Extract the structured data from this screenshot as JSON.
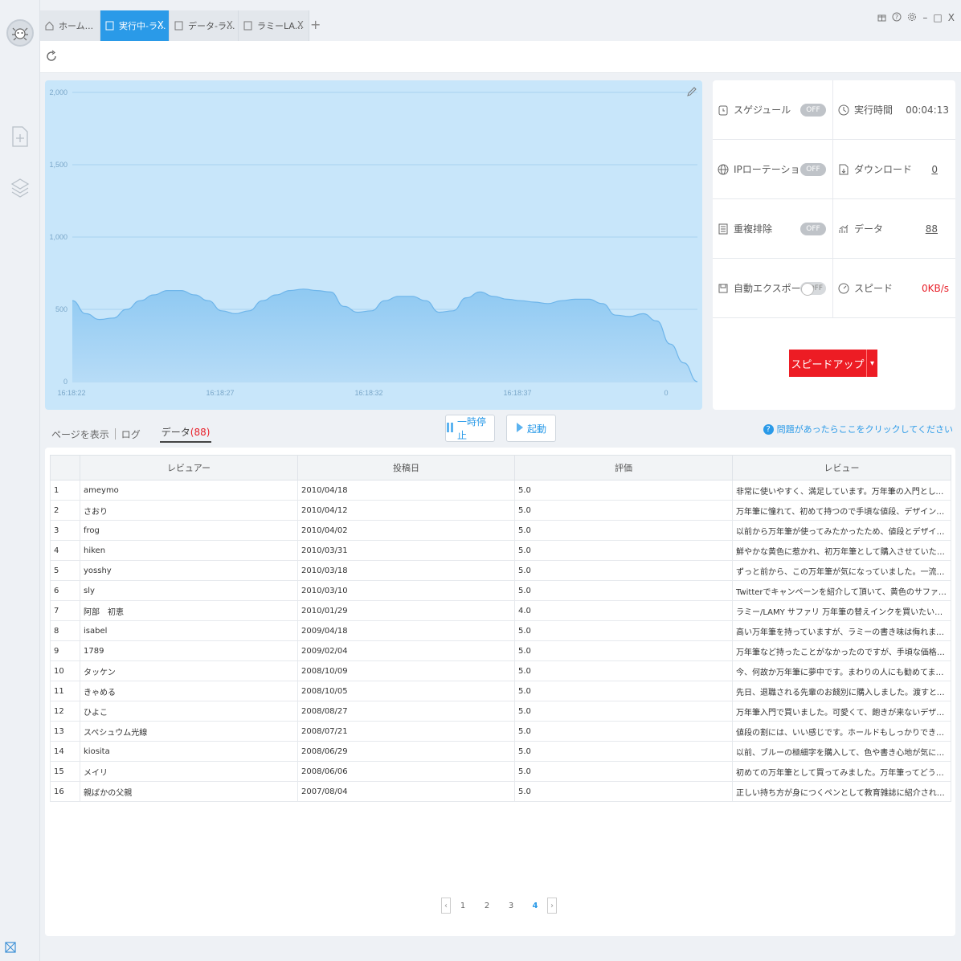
{
  "tabs": [
    {
      "label": "ホーム...",
      "icon": "home-icon",
      "active": false,
      "closable": false
    },
    {
      "label": "実行中-ラ...",
      "icon": "document-icon",
      "active": true,
      "closable": true
    },
    {
      "label": "データ-ラ...",
      "icon": "document-icon",
      "active": false,
      "closable": true
    },
    {
      "label": "ラミーLA...",
      "icon": "document-icon",
      "active": false,
      "closable": true
    }
  ],
  "tab_add": "+",
  "tab_close": "X",
  "window_controls": {
    "gift": "gift-icon",
    "help": "help-icon",
    "settings": "gear-icon",
    "minimize": "–",
    "maximize": "□",
    "close": "X"
  },
  "chart_data": {
    "type": "area",
    "x_tick_labels": [
      "16:18:22",
      "16:18:27",
      "16:18:32",
      "16:18:37",
      "0"
    ],
    "y_tick_labels": [
      "0",
      "500",
      "1,000",
      "1,500",
      "2,000"
    ],
    "ylim": [
      0,
      2000
    ],
    "grid": true,
    "series": [
      {
        "values": [
          560,
          470,
          430,
          440,
          500,
          560,
          600,
          630,
          630,
          600,
          560,
          490,
          470,
          490,
          560,
          600,
          630,
          640,
          630,
          620,
          520,
          480,
          490,
          560,
          590,
          590,
          560,
          480,
          490,
          580,
          620,
          590,
          570,
          560,
          550,
          540,
          560,
          570,
          570,
          540,
          460,
          450,
          470,
          420,
          260,
          130,
          0
        ]
      }
    ]
  },
  "status": {
    "schedule": {
      "label": "スゲジュール",
      "toggle": "OFF"
    },
    "run_time": {
      "label": "実行時間",
      "value": "00:04:13"
    },
    "ip_rotation": {
      "label": "IPローテーション",
      "toggle": "OFF"
    },
    "download": {
      "label": "ダウンロード",
      "value": "0"
    },
    "dedupe": {
      "label": "重複排除",
      "toggle": "OFF"
    },
    "data": {
      "label": "データ",
      "value": "88"
    },
    "auto_export": {
      "label": "自動エクスポート",
      "toggle": "OFF"
    },
    "speed": {
      "label": "スピード",
      "value": "0KB/s"
    },
    "speedup_label": "スピードアップ"
  },
  "subtabs": {
    "page": "ページを表示",
    "log": "ログ",
    "data": "データ",
    "data_count": "(88)"
  },
  "controls": {
    "pause": "一時停止",
    "start": "起動"
  },
  "help_text": "問題があったらここをクリックしてください",
  "table": {
    "headers": [
      "",
      "レビュアー",
      "投稿日",
      "評価",
      "レビュー"
    ],
    "rows": [
      [
        "1",
        "ameymo",
        "2010/04/18",
        "5.0",
        "非常に使いやすく、満足しています。万年筆の入門としては最適の一本だと..."
      ],
      [
        "2",
        "さおり",
        "2010/04/12",
        "5.0",
        "万年筆に憧れて、初めて持つので手頃な値段、デザインに惹かれ購入させてい..."
      ],
      [
        "3",
        "frog",
        "2010/04/02",
        "5.0",
        "以前から万年筆が使ってみたかったため、値段とデザインに惹かれ、青の中字..."
      ],
      [
        "4",
        "hiken",
        "2010/03/31",
        "5.0",
        "鮮やかな黄色に惹かれ、初万年筆として購入させていただきました。書き心地..."
      ],
      [
        "5",
        "yosshy",
        "2010/03/18",
        "5.0",
        "ずっと前から、この万年筆が気になっていました。一流ブランドのものを気軽..."
      ],
      [
        "6",
        "sly",
        "2010/03/10",
        "5.0",
        "Twitterでキャンペーンを紹介して頂いて、黄色のサファリを購入しました。さ..."
      ],
      [
        "7",
        "阿部　初恵",
        "2010/01/29",
        "4.0",
        "ラミー/LAMY サファリ 万年筆の替えインクを買いたいのですが、万年筆買っ..."
      ],
      [
        "8",
        "isabel",
        "2009/04/18",
        "5.0",
        "高い万年筆を持っていますが、ラミーの書き味は侮れません。軽いし、お手ご..."
      ],
      [
        "9",
        "1789",
        "2009/02/04",
        "5.0",
        "万年筆など持ったことがなかったのですが、手頃な価格とデザインに惹かれ購..."
      ],
      [
        "10",
        "タッケン",
        "2008/10/09",
        "5.0",
        "今、何故か万年筆に夢中です。まわりの人にも勧めてます。数ある筆記具の中..."
      ],
      [
        "11",
        "きゃめる",
        "2008/10/05",
        "5.0",
        "先日、退職される先輩のお餞別に購入しました。渡すと、先輩は包装をあけ..."
      ],
      [
        "12",
        "ひよこ",
        "2008/08/27",
        "5.0",
        "万年筆入門で買いました。可愛くて、飽きが来ないデザインが気に入ってま..."
      ],
      [
        "13",
        "スペシュウム光線",
        "2008/07/21",
        "5.0",
        "値段の割には、いい感じです。ホールドもしっかりできて、いいです。細字を..."
      ],
      [
        "14",
        "kiosita",
        "2008/06/29",
        "5.0",
        "以前、ブルーの極細字を購入して、色や書き心地が気に入って、今回はイエロ..."
      ],
      [
        "15",
        "メイリ",
        "2008/06/06",
        "5.0",
        "初めての万年筆として買ってみました。万年筆ってどうなの? と思い、ちょ..."
      ],
      [
        "16",
        "親ばかの父親",
        "2007/08/04",
        "5.0",
        "正しい持ち方が身につくペンとして教育雑誌に紹介されたこともあり、長女の..."
      ]
    ]
  },
  "pager": {
    "pages": [
      "1",
      "2",
      "3",
      "4"
    ],
    "current": "4",
    "prev": "‹",
    "next": "›"
  }
}
